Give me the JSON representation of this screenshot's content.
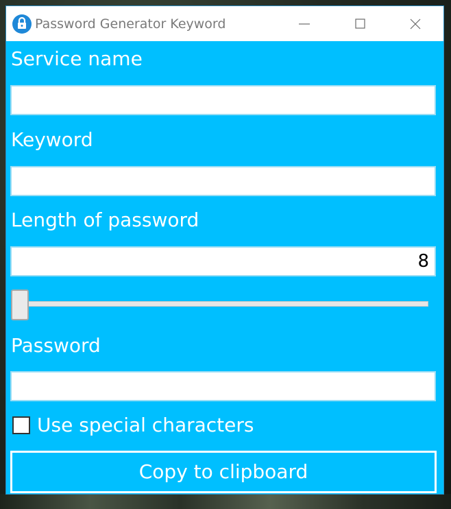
{
  "window": {
    "title": "Password Generator Keyword",
    "icon": "lock-icon",
    "controls": [
      "minimize-icon",
      "maximize-icon",
      "close-icon"
    ],
    "accent_color": "#00bfff"
  },
  "form": {
    "service_name": {
      "label": "Service name",
      "value": ""
    },
    "keyword": {
      "label": "Keyword",
      "value": ""
    },
    "length": {
      "label": "Length of password",
      "value": "8",
      "slider_value": 8
    },
    "password": {
      "label": "Password",
      "value": ""
    },
    "special_characters": {
      "label": "Use special characters",
      "checked": false
    },
    "copy_button": {
      "label": "Copy to clipboard"
    }
  }
}
